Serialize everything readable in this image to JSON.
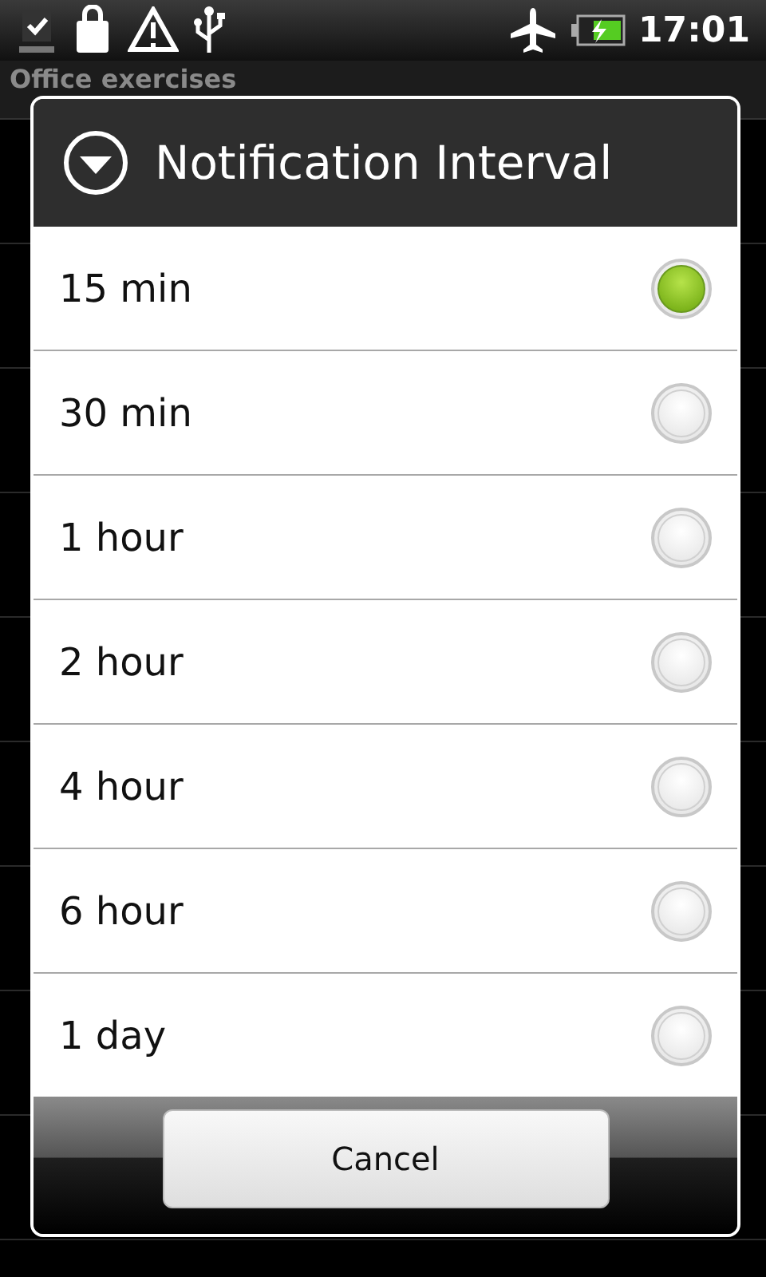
{
  "status_bar": {
    "time": "17:01"
  },
  "background_screen": {
    "title": "Office exercises"
  },
  "dialog": {
    "title": "Notification Interval",
    "options": [
      {
        "label": "15 min",
        "selected": true
      },
      {
        "label": "30 min",
        "selected": false
      },
      {
        "label": "1 hour",
        "selected": false
      },
      {
        "label": "2 hour",
        "selected": false
      },
      {
        "label": "4 hour",
        "selected": false
      },
      {
        "label": "6 hour",
        "selected": false
      },
      {
        "label": "1 day",
        "selected": false
      }
    ],
    "buttons": [
      "Cancel"
    ]
  }
}
